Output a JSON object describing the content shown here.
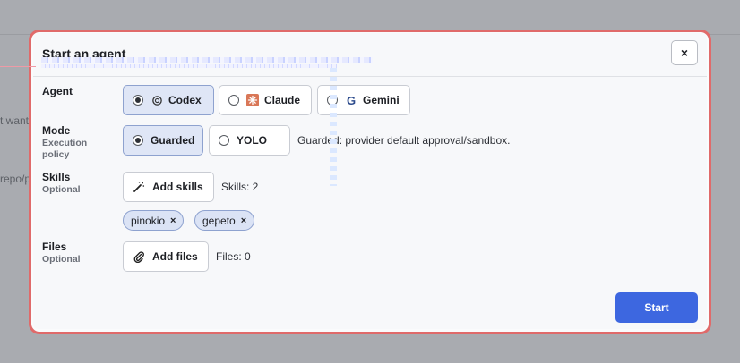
{
  "background": {
    "text_fragments": [
      "t want",
      "repo/pro"
    ]
  },
  "dialog": {
    "title": "Start an agent",
    "close_label": "×"
  },
  "agent": {
    "label": "Agent",
    "options": [
      {
        "label": "Codex",
        "selected": true,
        "icon": "openai-icon"
      },
      {
        "label": "Claude",
        "selected": false,
        "icon": "claude-icon"
      },
      {
        "label": "Gemini",
        "selected": false,
        "icon": "google-icon"
      }
    ]
  },
  "mode": {
    "label": "Mode",
    "sub_label": "Execution policy",
    "options": [
      {
        "label": "Guarded",
        "selected": true
      },
      {
        "label": "YOLO",
        "selected": false
      }
    ],
    "description": "Guarded: provider default approval/sandbox."
  },
  "skills": {
    "label": "Skills",
    "sub_label": "Optional",
    "add_label": "Add skills",
    "count_text": "Skills: 2",
    "chips": [
      "pinokio",
      "gepeto"
    ],
    "chip_remove": "×"
  },
  "files": {
    "label": "Files",
    "sub_label": "Optional",
    "add_label": "Add files",
    "count_text": "Files: 0"
  },
  "footer": {
    "start_label": "Start"
  },
  "colors": {
    "accent": "#3d67e0",
    "selected_bg": "#dfe6f6",
    "outline": "#e06a6a"
  }
}
